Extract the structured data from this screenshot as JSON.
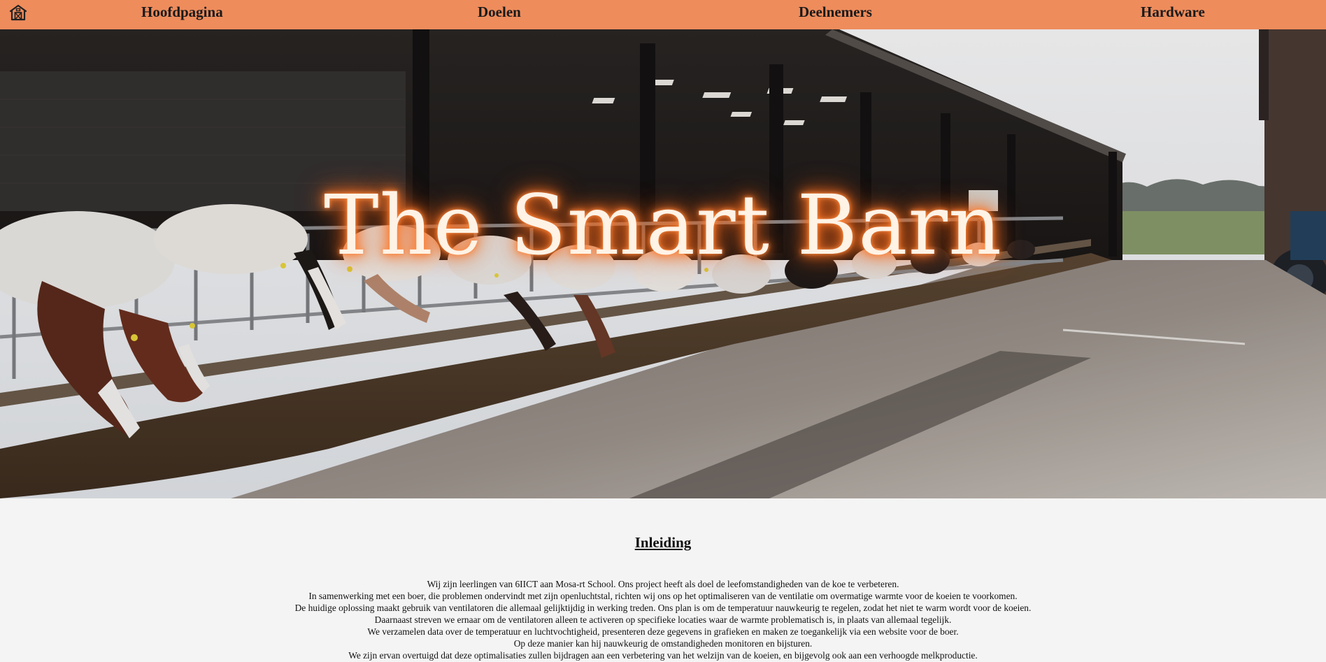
{
  "nav": {
    "logo_icon": "barn-icon",
    "items": [
      {
        "label": "Hoofdpagina"
      },
      {
        "label": "Doelen"
      },
      {
        "label": "Deelnemers"
      },
      {
        "label": "Hardware"
      }
    ],
    "background_color": "#ee8c5c"
  },
  "hero": {
    "title": "The Smart Barn",
    "image_subject": "cows feeding in an open barn"
  },
  "intro": {
    "heading": "Inleiding",
    "paragraphs": [
      "Wij zijn leerlingen van 6IICT aan Mosa-rt School. Ons project heeft als doel de leefomstandigheden van de koe te verbeteren.",
      "In samenwerking met een boer, die problemen ondervindt met zijn openluchtstal, richten wij ons op het optimaliseren van de ventilatie om overmatige warmte voor de koeien te voorkomen.",
      "De huidige oplossing maakt gebruik van ventilatoren die allemaal gelijktijdig in werking treden. Ons plan is om de temperatuur nauwkeurig te regelen, zodat het niet te warm wordt voor de koeien.",
      "Daarnaast streven we ernaar om de ventilatoren alleen te activeren op specifieke locaties waar de warmte problematisch is, in plaats van allemaal tegelijk.",
      "We verzamelen data over de temperatuur en luchtvochtigheid, presenteren deze gegevens in grafieken en maken ze toegankelijk via een website voor de boer.",
      "Op deze manier kan hij nauwkeurig de omstandigheden monitoren en bijsturen.",
      "We zijn ervan overtuigd dat deze optimalisaties zullen bijdragen aan een verbetering van het welzijn van de koeien, en bijgevolg ook aan een verhoogde melkproductie."
    ]
  }
}
